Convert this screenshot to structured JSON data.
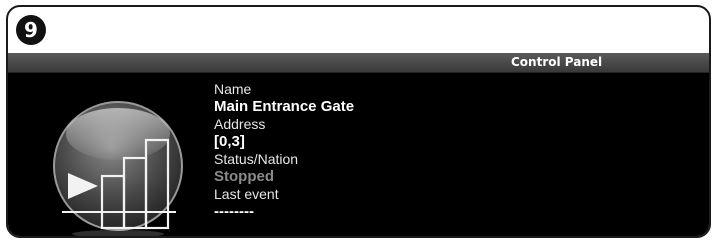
{
  "step_badge": "9",
  "panel": {
    "title": "Control Panel"
  },
  "device": {
    "icon": "gate-status-icon",
    "fields": [
      {
        "label": "Name",
        "value": "Main Entrance Gate"
      },
      {
        "label": "Address",
        "value": "[0,3]"
      },
      {
        "label": "Status/Nation",
        "value": "Stopped"
      },
      {
        "label": "Last event",
        "value": "--------"
      }
    ]
  }
}
